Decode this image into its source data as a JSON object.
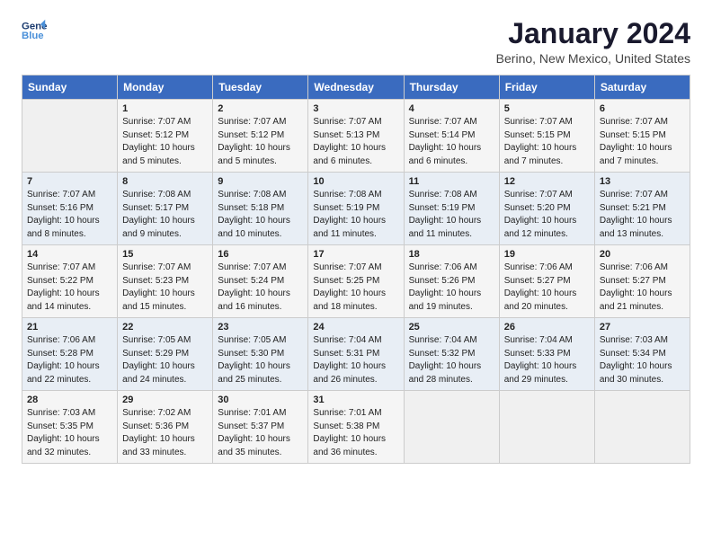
{
  "logo": {
    "line1": "General",
    "line2": "Blue"
  },
  "title": "January 2024",
  "subtitle": "Berino, New Mexico, United States",
  "days_of_week": [
    "Sunday",
    "Monday",
    "Tuesday",
    "Wednesday",
    "Thursday",
    "Friday",
    "Saturday"
  ],
  "weeks": [
    [
      {
        "day": "",
        "info": ""
      },
      {
        "day": "1",
        "info": "Sunrise: 7:07 AM\nSunset: 5:12 PM\nDaylight: 10 hours\nand 5 minutes."
      },
      {
        "day": "2",
        "info": "Sunrise: 7:07 AM\nSunset: 5:12 PM\nDaylight: 10 hours\nand 5 minutes."
      },
      {
        "day": "3",
        "info": "Sunrise: 7:07 AM\nSunset: 5:13 PM\nDaylight: 10 hours\nand 6 minutes."
      },
      {
        "day": "4",
        "info": "Sunrise: 7:07 AM\nSunset: 5:14 PM\nDaylight: 10 hours\nand 6 minutes."
      },
      {
        "day": "5",
        "info": "Sunrise: 7:07 AM\nSunset: 5:15 PM\nDaylight: 10 hours\nand 7 minutes."
      },
      {
        "day": "6",
        "info": "Sunrise: 7:07 AM\nSunset: 5:15 PM\nDaylight: 10 hours\nand 7 minutes."
      }
    ],
    [
      {
        "day": "7",
        "info": "Sunrise: 7:07 AM\nSunset: 5:16 PM\nDaylight: 10 hours\nand 8 minutes."
      },
      {
        "day": "8",
        "info": "Sunrise: 7:08 AM\nSunset: 5:17 PM\nDaylight: 10 hours\nand 9 minutes."
      },
      {
        "day": "9",
        "info": "Sunrise: 7:08 AM\nSunset: 5:18 PM\nDaylight: 10 hours\nand 10 minutes."
      },
      {
        "day": "10",
        "info": "Sunrise: 7:08 AM\nSunset: 5:19 PM\nDaylight: 10 hours\nand 11 minutes."
      },
      {
        "day": "11",
        "info": "Sunrise: 7:08 AM\nSunset: 5:19 PM\nDaylight: 10 hours\nand 11 minutes."
      },
      {
        "day": "12",
        "info": "Sunrise: 7:07 AM\nSunset: 5:20 PM\nDaylight: 10 hours\nand 12 minutes."
      },
      {
        "day": "13",
        "info": "Sunrise: 7:07 AM\nSunset: 5:21 PM\nDaylight: 10 hours\nand 13 minutes."
      }
    ],
    [
      {
        "day": "14",
        "info": "Sunrise: 7:07 AM\nSunset: 5:22 PM\nDaylight: 10 hours\nand 14 minutes."
      },
      {
        "day": "15",
        "info": "Sunrise: 7:07 AM\nSunset: 5:23 PM\nDaylight: 10 hours\nand 15 minutes."
      },
      {
        "day": "16",
        "info": "Sunrise: 7:07 AM\nSunset: 5:24 PM\nDaylight: 10 hours\nand 16 minutes."
      },
      {
        "day": "17",
        "info": "Sunrise: 7:07 AM\nSunset: 5:25 PM\nDaylight: 10 hours\nand 18 minutes."
      },
      {
        "day": "18",
        "info": "Sunrise: 7:06 AM\nSunset: 5:26 PM\nDaylight: 10 hours\nand 19 minutes."
      },
      {
        "day": "19",
        "info": "Sunrise: 7:06 AM\nSunset: 5:27 PM\nDaylight: 10 hours\nand 20 minutes."
      },
      {
        "day": "20",
        "info": "Sunrise: 7:06 AM\nSunset: 5:27 PM\nDaylight: 10 hours\nand 21 minutes."
      }
    ],
    [
      {
        "day": "21",
        "info": "Sunrise: 7:06 AM\nSunset: 5:28 PM\nDaylight: 10 hours\nand 22 minutes."
      },
      {
        "day": "22",
        "info": "Sunrise: 7:05 AM\nSunset: 5:29 PM\nDaylight: 10 hours\nand 24 minutes."
      },
      {
        "day": "23",
        "info": "Sunrise: 7:05 AM\nSunset: 5:30 PM\nDaylight: 10 hours\nand 25 minutes."
      },
      {
        "day": "24",
        "info": "Sunrise: 7:04 AM\nSunset: 5:31 PM\nDaylight: 10 hours\nand 26 minutes."
      },
      {
        "day": "25",
        "info": "Sunrise: 7:04 AM\nSunset: 5:32 PM\nDaylight: 10 hours\nand 28 minutes."
      },
      {
        "day": "26",
        "info": "Sunrise: 7:04 AM\nSunset: 5:33 PM\nDaylight: 10 hours\nand 29 minutes."
      },
      {
        "day": "27",
        "info": "Sunrise: 7:03 AM\nSunset: 5:34 PM\nDaylight: 10 hours\nand 30 minutes."
      }
    ],
    [
      {
        "day": "28",
        "info": "Sunrise: 7:03 AM\nSunset: 5:35 PM\nDaylight: 10 hours\nand 32 minutes."
      },
      {
        "day": "29",
        "info": "Sunrise: 7:02 AM\nSunset: 5:36 PM\nDaylight: 10 hours\nand 33 minutes."
      },
      {
        "day": "30",
        "info": "Sunrise: 7:01 AM\nSunset: 5:37 PM\nDaylight: 10 hours\nand 35 minutes."
      },
      {
        "day": "31",
        "info": "Sunrise: 7:01 AM\nSunset: 5:38 PM\nDaylight: 10 hours\nand 36 minutes."
      },
      {
        "day": "",
        "info": ""
      },
      {
        "day": "",
        "info": ""
      },
      {
        "day": "",
        "info": ""
      }
    ]
  ]
}
